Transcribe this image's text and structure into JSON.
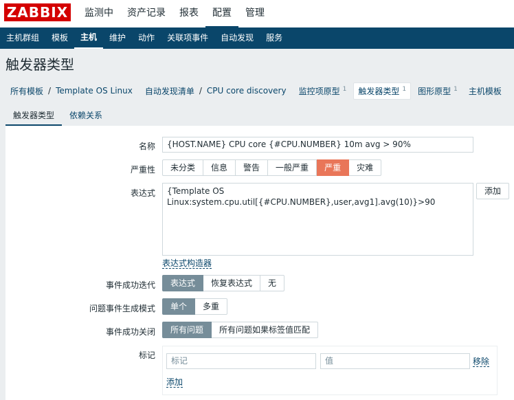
{
  "logo": "ZABBIX",
  "top_nav": [
    {
      "label": "监测中",
      "active": false
    },
    {
      "label": "资产记录",
      "active": false
    },
    {
      "label": "报表",
      "active": false
    },
    {
      "label": "配置",
      "active": true
    },
    {
      "label": "管理",
      "active": false
    }
  ],
  "sub_nav": [
    {
      "label": "主机群组",
      "active": false
    },
    {
      "label": "模板",
      "active": false
    },
    {
      "label": "主机",
      "active": true
    },
    {
      "label": "维护",
      "active": false
    },
    {
      "label": "动作",
      "active": false
    },
    {
      "label": "关联项事件",
      "active": false
    },
    {
      "label": "自动发现",
      "active": false
    },
    {
      "label": "服务",
      "active": false
    }
  ],
  "page_title": "触发器类型",
  "breadcrumb": {
    "all_templates": "所有模板",
    "template": "Template OS Linux",
    "discovery_list": "自动发现清单",
    "discovery_rule": "CPU core discovery",
    "tabs": [
      {
        "label": "监控项原型",
        "count": "1",
        "selected": false
      },
      {
        "label": "触发器类型",
        "count": "1",
        "selected": true
      },
      {
        "label": "图形原型",
        "count": "1",
        "selected": false
      },
      {
        "label": "主机模板",
        "count": "",
        "selected": false
      }
    ]
  },
  "form_tabs": [
    {
      "label": "触发器类型",
      "active": true
    },
    {
      "label": "依赖关系",
      "active": false
    }
  ],
  "form": {
    "name_label": "名称",
    "name_value": "{HOST.NAME} CPU core {#CPU.NUMBER} 10m avg > 90%",
    "severity_label": "严重性",
    "severity_options": [
      "未分类",
      "信息",
      "警告",
      "一般严重",
      "严重",
      "灾难"
    ],
    "severity_selected": "严重",
    "expression_label": "表达式",
    "expression_value": "{Template OS Linux:system.cpu.util[{#CPU.NUMBER},user,avg1].avg(10)}>90",
    "add_button": "添加",
    "expression_builder": "表达式构造器",
    "ok_event_gen_label": "事件成功迭代",
    "ok_event_gen_options": [
      "表达式",
      "恢复表达式",
      "无"
    ],
    "ok_event_gen_selected": "表达式",
    "problem_mode_label": "问题事件生成模式",
    "problem_mode_options": [
      "单个",
      "多重"
    ],
    "problem_mode_selected": "单个",
    "ok_close_label": "事件成功关闭",
    "ok_close_options": [
      "所有问题",
      "所有问题如果标签值匹配"
    ],
    "ok_close_selected": "所有问题",
    "tags_label": "标记",
    "tag_name_placeholder": "标记",
    "tag_value_placeholder": "值",
    "tag_remove": "移除",
    "tag_add": "添加"
  },
  "colors": {
    "brand": "#d40000",
    "nav_bg": "#0a466a",
    "selected_severity": "#e97659",
    "toggle_on": "#768d99"
  }
}
